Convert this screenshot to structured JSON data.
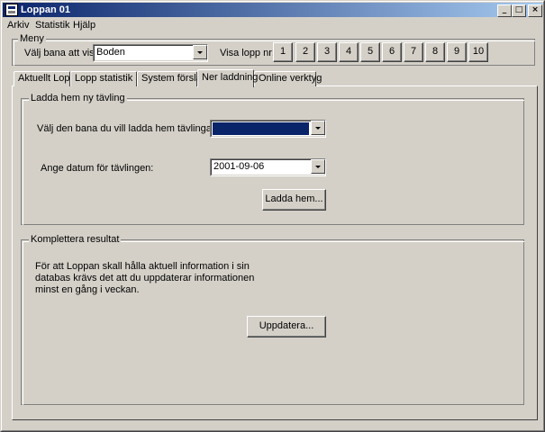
{
  "window": {
    "title": "Loppan 01"
  },
  "menu": {
    "arkiv": "Arkiv",
    "statistik": "Statistik",
    "hjalp": "Hjälp"
  },
  "meny_group": {
    "legend": "Meny",
    "bana_label": "Välj bana att visa:",
    "bana_value": "Boden",
    "visa_lopp_label": "Visa lopp nr:",
    "lopp_buttons": [
      "1",
      "2",
      "3",
      "4",
      "5",
      "6",
      "7",
      "8",
      "9",
      "10"
    ]
  },
  "tabs": [
    "Aktuellt Lopp",
    "Lopp statistik",
    "System förslag",
    "Ner laddning",
    "Online verktyg"
  ],
  "active_tab": "Ner laddning",
  "download_group": {
    "legend": "Ladda hem ny tävling",
    "bana_label": "Välj den bana du vill ladda hem tävlingar ifrån:",
    "bana_value": "",
    "datum_label": "Ange datum för tävlingen:",
    "datum_value": "2001-09-06",
    "download_button": "Ladda hem..."
  },
  "complete_group": {
    "legend": "Komplettera resultat",
    "info_text": "För att Loppan skall hålla aktuell information i sin databas krävs det att du uppdaterar informationen minst en gång i veckan.",
    "update_button": "Uppdatera..."
  },
  "colors": {
    "titlebar_start": "#0a246a",
    "titlebar_end": "#a6caf0",
    "face": "#d4d0c8",
    "selection": "#0a246a"
  }
}
